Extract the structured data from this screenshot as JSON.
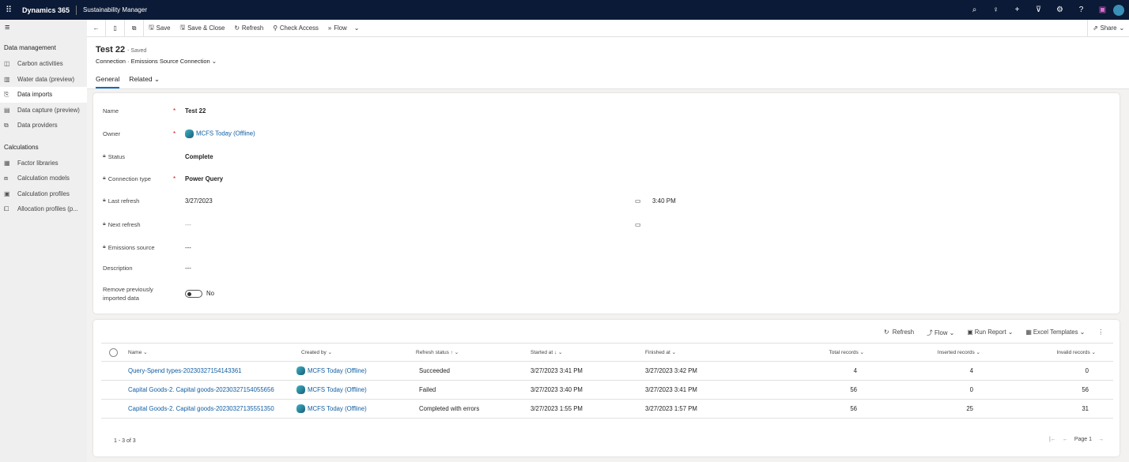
{
  "topbar": {
    "brand": "Dynamics 365",
    "app": "Sustainability Manager",
    "icons": [
      "search-icon",
      "lightbulb-icon",
      "plus-icon",
      "filter-icon",
      "gear-icon",
      "help-icon",
      "teams-icon",
      "avatar"
    ]
  },
  "sidebar": {
    "groups": [
      {
        "label": "Data management",
        "items": [
          {
            "label": "Carbon activities",
            "selected": false
          },
          {
            "label": "Water data (preview)",
            "selected": false
          },
          {
            "label": "Data imports",
            "selected": true
          },
          {
            "label": "Data capture (preview)",
            "selected": false
          },
          {
            "label": "Data providers",
            "selected": false
          }
        ]
      },
      {
        "label": "Calculations",
        "items": [
          {
            "label": "Factor libraries"
          },
          {
            "label": "Calculation models"
          },
          {
            "label": "Calculation profiles"
          },
          {
            "label": "Allocation profiles (p..."
          }
        ]
      }
    ]
  },
  "commandbar": {
    "save": "Save",
    "save_close": "Save & Close",
    "refresh": "Refresh",
    "check_access": "Check Access",
    "flow": "Flow",
    "share": "Share"
  },
  "header": {
    "title": "Test 22",
    "saved": "- Saved",
    "entity": "Connection",
    "form": "Emissions Source Connection",
    "tabs": [
      "General",
      "Related"
    ]
  },
  "form": {
    "name": {
      "label": "Name",
      "value": "Test 22"
    },
    "owner": {
      "label": "Owner",
      "value": "MCFS Today (Offline)"
    },
    "status": {
      "label": "Status",
      "value": "Complete"
    },
    "connection_type": {
      "label": "Connection type",
      "value": "Power Query"
    },
    "last_refresh": {
      "label": "Last refresh",
      "date": "3/27/2023",
      "time": "3:40 PM"
    },
    "next_refresh": {
      "label": "Next refresh",
      "date": "---"
    },
    "emissions_source": {
      "label": "Emissions source",
      "value": "---"
    },
    "description": {
      "label": "Description",
      "value": "---"
    },
    "remove": {
      "label1": "Remove previously",
      "label2": "imported data",
      "value": "No"
    }
  },
  "grid": {
    "toolbar": {
      "refresh": "Refresh",
      "flow": "Flow",
      "run_report": "Run Report",
      "excel": "Excel Templates"
    },
    "columns": [
      "Name",
      "Created by",
      "Refresh status",
      "Started at",
      "Finished at",
      "Total records",
      "Inserted records",
      "Invalid records"
    ],
    "rows": [
      {
        "name": "Query-Spend types-20230327154143361",
        "created_by": "MCFS Today (Offline)",
        "status": "Succeeded",
        "started": "3/27/2023 3:41 PM",
        "finished": "3/27/2023 3:42 PM",
        "total": "4",
        "inserted": "4",
        "invalid": "0"
      },
      {
        "name": "Capital Goods-2. Capital goods-20230327154055656",
        "created_by": "MCFS Today (Offline)",
        "status": "Failed",
        "started": "3/27/2023 3:40 PM",
        "finished": "3/27/2023 3:41 PM",
        "total": "56",
        "inserted": "0",
        "invalid": "56"
      },
      {
        "name": "Capital Goods-2. Capital goods-20230327135551350",
        "created_by": "MCFS Today (Offline)",
        "status": "Completed with errors",
        "started": "3/27/2023 1:55 PM",
        "finished": "3/27/2023 1:57 PM",
        "total": "56",
        "inserted": "25",
        "invalid": "31"
      }
    ],
    "count": "1 - 3 of 3",
    "page": "Page 1"
  }
}
